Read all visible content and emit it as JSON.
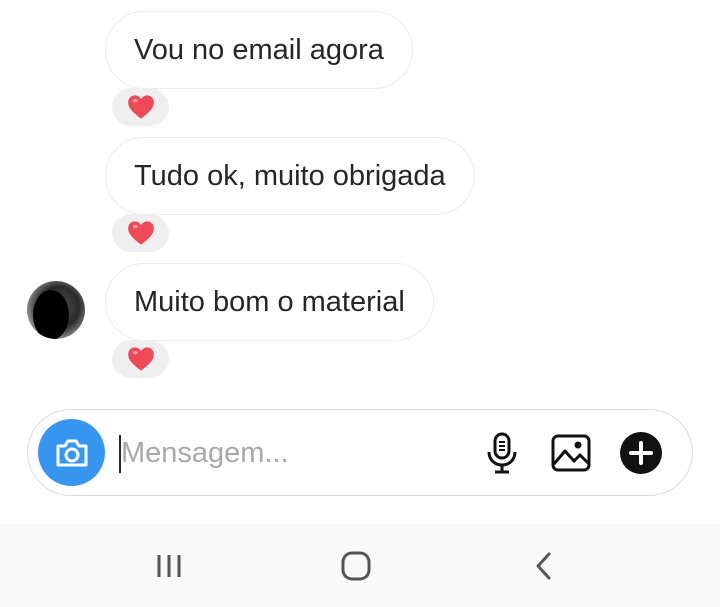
{
  "messages": [
    {
      "text": "Vou no email agora",
      "reaction": "heart"
    },
    {
      "text": "Tudo ok, muito obrigada",
      "reaction": "heart"
    },
    {
      "text": "Muito bom o material",
      "reaction": "heart"
    }
  ],
  "composer": {
    "placeholder": "Mensagem...",
    "value": ""
  },
  "icons": {
    "camera": "camera-icon",
    "microphone": "microphone-icon",
    "gallery": "gallery-icon",
    "add": "plus-circle-icon",
    "reaction": "heart-icon"
  },
  "colors": {
    "accent": "#3797f0",
    "heart": "#ed4956",
    "text": "#262626",
    "placeholder": "#a8a8a8"
  },
  "navbar": {
    "buttons": [
      "recent-apps",
      "home",
      "back"
    ]
  }
}
